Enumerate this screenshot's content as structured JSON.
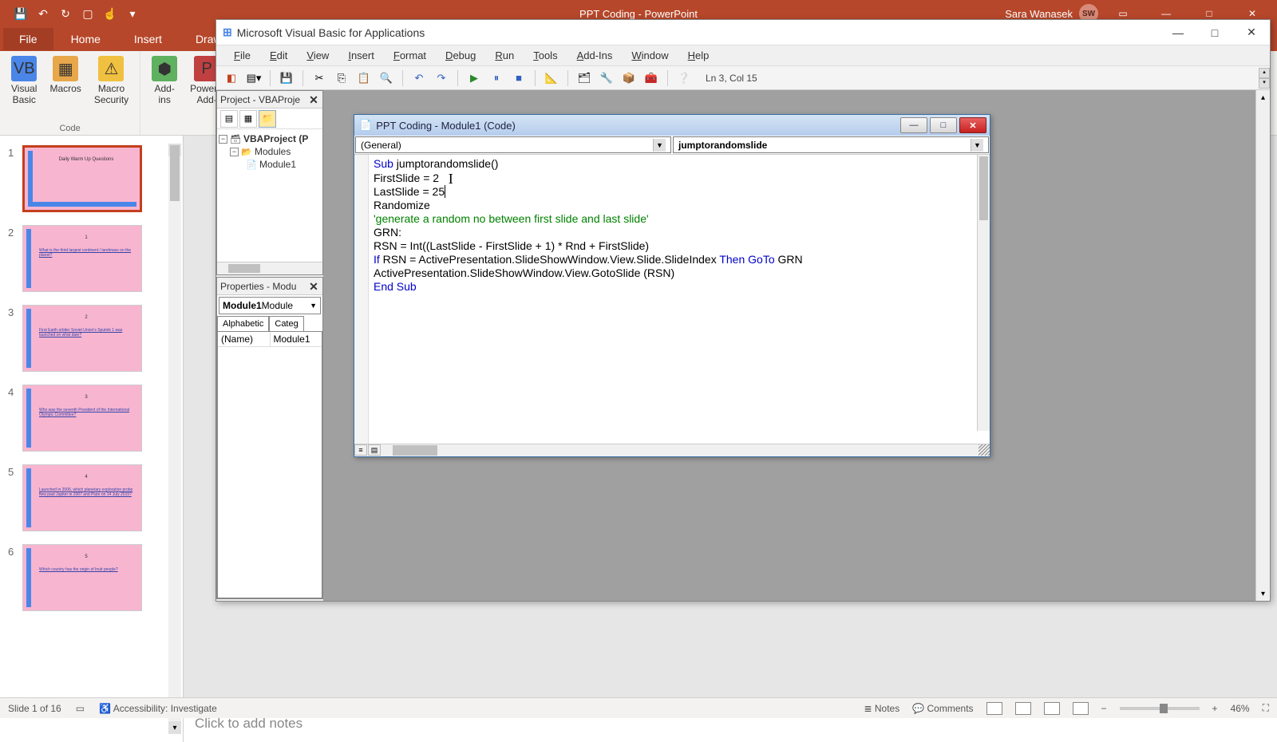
{
  "ppt": {
    "title": "PPT Coding  -  PowerPoint",
    "user_name": "Sara Wanasek",
    "user_initials": "SW",
    "tabs": {
      "file": "File",
      "home": "Home",
      "insert": "Insert",
      "draw": "Draw"
    },
    "ribbon": {
      "visual_basic": "Visual\nBasic",
      "macros": "Macros",
      "macro_security": "Macro\nSecurity",
      "addins": "Add-\nins",
      "ppt_addins": "PowerP\nAdd-",
      "com_addins": "Add-",
      "group_code": "Code"
    },
    "thumbnails": [
      {
        "num": "1",
        "title": "Daily Warm Up Questions",
        "q": ""
      },
      {
        "num": "2",
        "title": "1",
        "q": "What is the third largest continent / landmass on the planet?"
      },
      {
        "num": "3",
        "title": "2",
        "q": "First Earth orbiter Soviet Union's Sputnik 1 was launched on what date?"
      },
      {
        "num": "4",
        "title": "3",
        "q": "Who was the seventh President of the International Olympic Committee?"
      },
      {
        "num": "5",
        "title": "4",
        "q": "Launched in 2006, which planetary exploration probe flew past Jupiter in 2007 and Pluto on 14 July 2015?"
      },
      {
        "num": "6",
        "title": "5",
        "q": "Which country has the origin of Inuit people?"
      }
    ],
    "notes_placeholder": "Click to add notes",
    "status": {
      "slide_pos": "Slide 1 of 16",
      "accessibility": "Accessibility: Investigate",
      "notes": "Notes",
      "comments": "Comments",
      "zoom": "46%"
    }
  },
  "vba": {
    "window_title": "Microsoft Visual Basic for Applications",
    "menu": [
      "File",
      "Edit",
      "View",
      "Insert",
      "Format",
      "Debug",
      "Run",
      "Tools",
      "Add-Ins",
      "Window",
      "Help"
    ],
    "cursor_pos": "Ln 3, Col 15",
    "project_title": "Project - VBAProje",
    "project_root": "VBAProject (P",
    "modules_folder": "Modules",
    "module_name": "Module1",
    "properties_title": "Properties - Modu",
    "prop_combo": "Module1",
    "prop_combo_type": " Module",
    "prop_tab_alpha": "Alphabetic",
    "prop_tab_cat": "Categ",
    "prop_name_key": "(Name)",
    "prop_name_val": "Module1",
    "code": {
      "title": "PPT Coding - Module1 (Code)",
      "dd_left": "(General)",
      "dd_right": "jumptorandomslide",
      "lines": [
        {
          "t": "Sub jumptorandomslide()",
          "kw_ranges": [
            [
              0,
              3
            ]
          ]
        },
        {
          "t": "FirstSlide = 2"
        },
        {
          "t": "LastSlide = 25",
          "caret_after": true
        },
        {
          "t": ""
        },
        {
          "t": "Randomize"
        },
        {
          "t": "'generate a random no between first slide and last slide'",
          "cmt": true
        },
        {
          "t": ""
        },
        {
          "t": "GRN:"
        },
        {
          "t": "RSN = Int((LastSlide - FirstSlide + 1) * Rnd + FirstSlide)"
        },
        {
          "t": ""
        },
        {
          "t": "If RSN = ActivePresentation.SlideShowWindow.View.Slide.SlideIndex Then GoTo GRN",
          "kw_ranges": [
            [
              0,
              2
            ],
            [
              66,
              70
            ],
            [
              71,
              75
            ]
          ]
        },
        {
          "t": "ActivePresentation.SlideShowWindow.View.GotoSlide (RSN)"
        },
        {
          "t": "End Sub",
          "kw_ranges": [
            [
              0,
              7
            ]
          ]
        }
      ]
    }
  }
}
